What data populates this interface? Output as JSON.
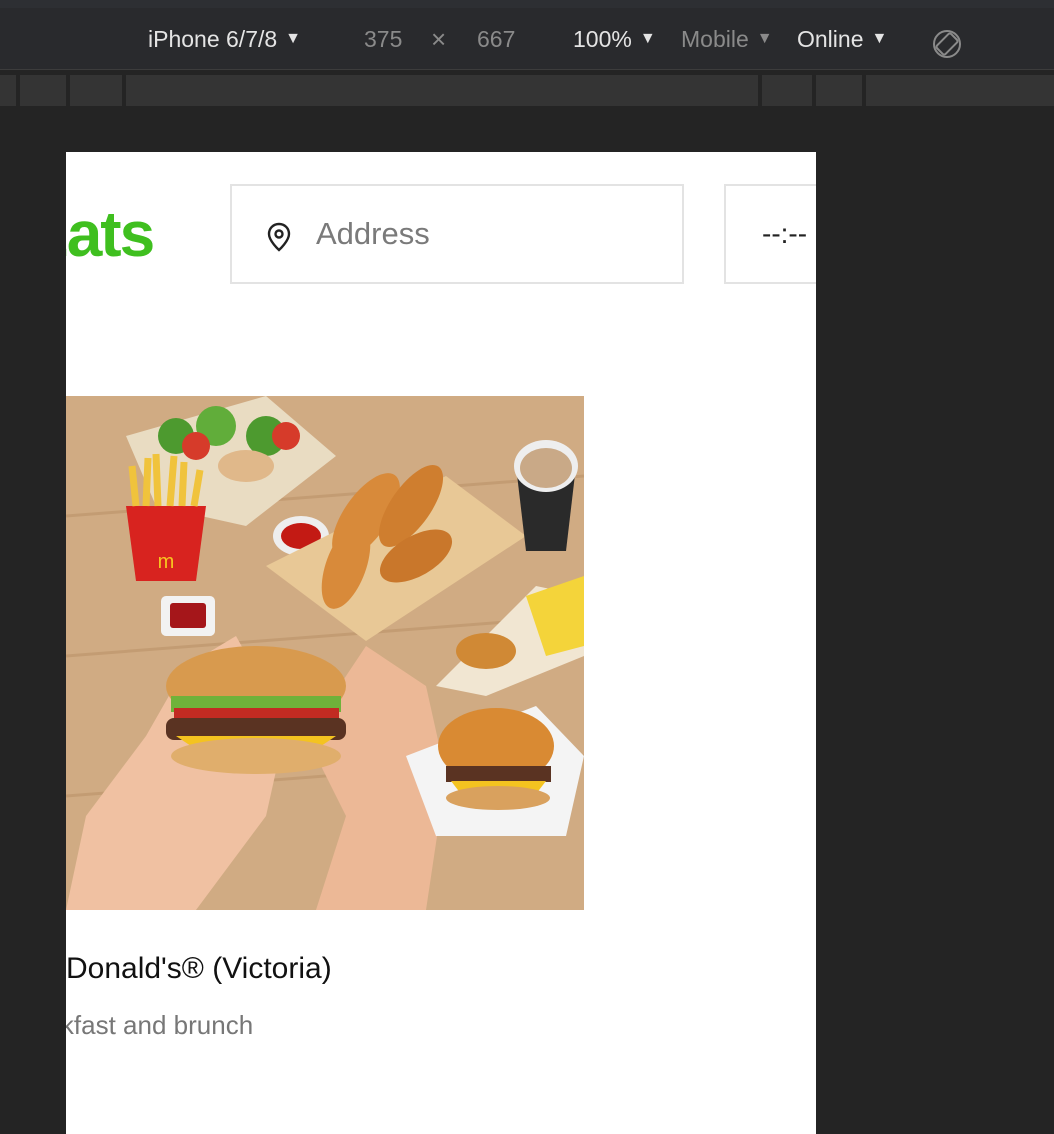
{
  "devtools": {
    "device": "iPhone 6/7/8",
    "width": "375",
    "times": "×",
    "height": "667",
    "zoom": "100%",
    "mode": "Mobile",
    "network": "Online",
    "caret": "▼"
  },
  "page": {
    "logo_text": "Eats",
    "address_placeholder": "Address",
    "time_value": "--:--",
    "store_title": "McDonald's® (Victoria)",
    "store_category": "Breakfast and brunch"
  },
  "colors": {
    "brand_green": "#3fbf1f",
    "devtools_bg": "#292a2d"
  }
}
